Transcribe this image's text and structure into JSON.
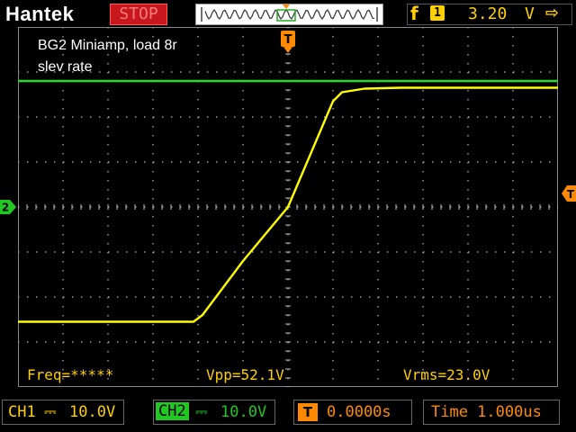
{
  "brand": "Hantek",
  "run_state": "STOP",
  "trigger": {
    "edge_symbol": "f",
    "source": "1",
    "level": "3.20",
    "unit": "V",
    "arrow": "⇨"
  },
  "screen_notes": {
    "line1": "BG2 Miniamp, load 8r",
    "line2": "slev rate"
  },
  "measurements": {
    "freq": "Freq=*****",
    "vpp": "Vpp=52.1V",
    "vrms": "Vrms=23.0V"
  },
  "markers": {
    "trigger_position": "T",
    "channel2": "2",
    "trigger_level": "T"
  },
  "bottom": {
    "ch1_name": "CH1",
    "ch1_coupling": "⎓",
    "ch1_scale": "10.0V",
    "ch2_name": "CH2",
    "ch2_coupling": "⎓",
    "ch2_scale": "10.0V",
    "trig_icon": "T",
    "trig_delay": "0.0000s",
    "timebase": "Time 1.000us"
  },
  "colors": {
    "ch1_trace": "#ffff00",
    "ch2_trace": "#22dd22",
    "trigger": "#ff8a00",
    "stop": "#c8181e"
  },
  "chart_data": {
    "type": "line",
    "title": "",
    "xlabel": "",
    "ylabel": "",
    "x_divisions": 12,
    "y_divisions": 8,
    "grid": true,
    "series": [
      {
        "name": "CH1",
        "color": "#ffff00",
        "x_div": [
          -6.0,
          -2.1,
          -1.9,
          -1.0,
          0.0,
          1.0,
          1.2,
          1.7,
          2.5,
          6.0
        ],
        "y_div": [
          -2.55,
          -2.55,
          -2.4,
          -1.2,
          0.0,
          2.35,
          2.55,
          2.63,
          2.65,
          2.65
        ]
      },
      {
        "name": "CH2",
        "color": "#22dd22",
        "x_div": [
          -6.0,
          6.0
        ],
        "y_div": [
          2.8,
          2.8
        ]
      }
    ]
  }
}
